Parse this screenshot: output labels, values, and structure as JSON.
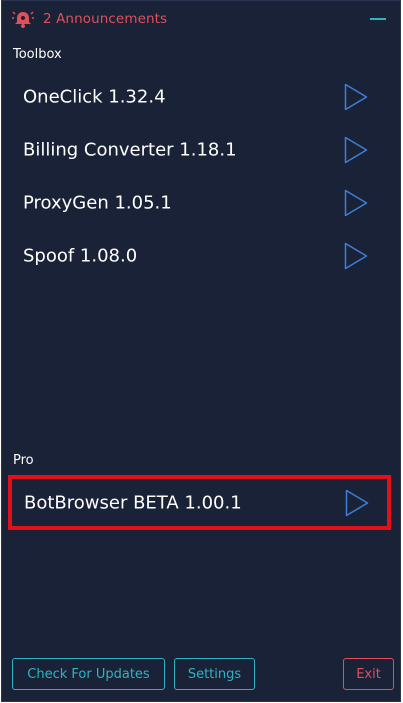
{
  "titlebar": {
    "announcements_label": "2 Announcements",
    "icon": "bell-icon",
    "minimize_icon": "minimize-icon"
  },
  "sections": {
    "toolbox_label": "Toolbox",
    "pro_label": "Pro"
  },
  "toolbox": {
    "items": [
      {
        "label": "OneClick 1.32.4"
      },
      {
        "label": "Billing Converter 1.18.1"
      },
      {
        "label": "ProxyGen 1.05.1"
      },
      {
        "label": "Spoof 1.08.0"
      }
    ]
  },
  "pro": {
    "items": [
      {
        "label": "BotBrowser BETA 1.00.1"
      }
    ]
  },
  "footer": {
    "check_updates_label": "Check For Updates",
    "settings_label": "Settings",
    "exit_label": "Exit"
  },
  "colors": {
    "background": "#1a2238",
    "accent": "#2fb3c4",
    "alert": "#e0505a",
    "highlight_border": "#e3101a",
    "play_icon": "#3d7fd6"
  }
}
